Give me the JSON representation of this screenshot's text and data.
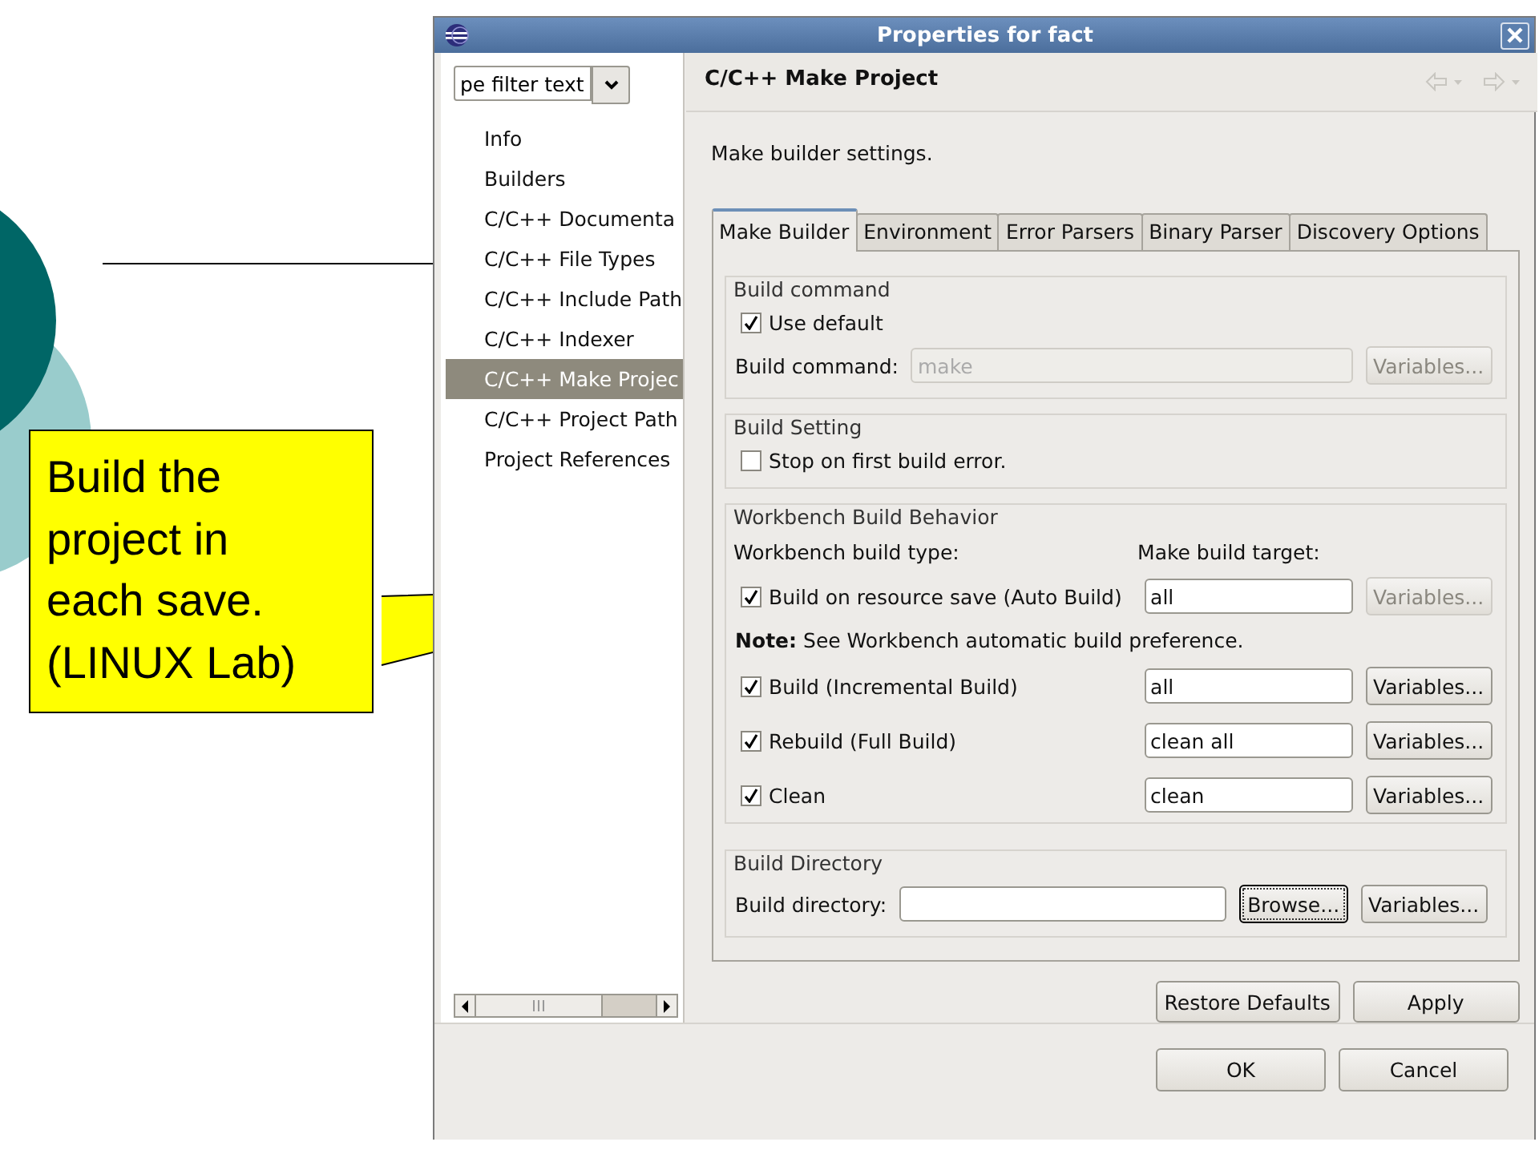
{
  "slide": {
    "callout": {
      "text": "Build the project in each save. (LINUX Lab)"
    }
  },
  "dialog": {
    "title": "Properties for fact",
    "filter": {
      "value": "pe filter text"
    },
    "nav_items": [
      {
        "label": "Info",
        "selected": false
      },
      {
        "label": "Builders",
        "selected": false
      },
      {
        "label": "C/C++ Documenta",
        "selected": false
      },
      {
        "label": "C/C++ File Types",
        "selected": false
      },
      {
        "label": "C/C++ Include Path",
        "selected": false
      },
      {
        "label": "C/C++ Indexer",
        "selected": false
      },
      {
        "label": "C/C++ Make Projec",
        "selected": true
      },
      {
        "label": "C/C++ Project Path",
        "selected": false
      },
      {
        "label": "Project References",
        "selected": false
      }
    ],
    "page_title": "C/C++ Make Project",
    "description": "Make builder settings.",
    "tabs": [
      {
        "label": "Make Builder",
        "selected": true
      },
      {
        "label": "Environment",
        "selected": false
      },
      {
        "label": "Error Parsers",
        "selected": false
      },
      {
        "label": "Binary Parser",
        "selected": false
      },
      {
        "label": "Discovery Options",
        "selected": false
      }
    ],
    "groups": [
      {
        "kind": "command",
        "title": "Build command",
        "checkbox": {
          "label": "Use default",
          "checked": true
        },
        "field_label": "Build command:",
        "field_value": "make",
        "field_disabled": true,
        "button": {
          "label": "Variables...",
          "disabled": true
        }
      },
      {
        "kind": "setting",
        "title": "Build Setting",
        "checkbox": {
          "label": "Stop on first build error.",
          "checked": false
        }
      },
      {
        "kind": "behavior",
        "title": "Workbench Build Behavior",
        "type_header": "Workbench build type:",
        "target_header": "Make build target:",
        "rows": [
          {
            "kind": "target",
            "label": "Build on resource save (Auto Build)",
            "checked": true,
            "target": "all",
            "button": {
              "label": "Variables...",
              "disabled": true
            }
          },
          {
            "kind": "note",
            "text": "**Note:** See Workbench automatic build preference."
          },
          {
            "kind": "target",
            "label": "Build (Incremental Build)",
            "checked": true,
            "target": "all",
            "button": {
              "label": "Variables...",
              "disabled": false
            }
          },
          {
            "kind": "target",
            "label": "Rebuild (Full Build)",
            "checked": true,
            "target": "clean all",
            "button": {
              "label": "Variables...",
              "disabled": false
            }
          },
          {
            "kind": "target",
            "label": "Clean",
            "checked": true,
            "target": "clean",
            "button": {
              "label": "Variables...",
              "disabled": false
            }
          }
        ]
      },
      {
        "kind": "directory",
        "title": "Build Directory",
        "field_label": "Build directory:",
        "browse": {
          "label": "Browse...",
          "focused": true
        },
        "button": {
          "label": "Variables...",
          "disabled": false
        }
      }
    ],
    "page_buttons": [
      {
        "label": "Restore Defaults"
      },
      {
        "label": "Apply"
      }
    ],
    "buttons": [
      {
        "label": "OK"
      },
      {
        "label": "Cancel"
      }
    ]
  }
}
